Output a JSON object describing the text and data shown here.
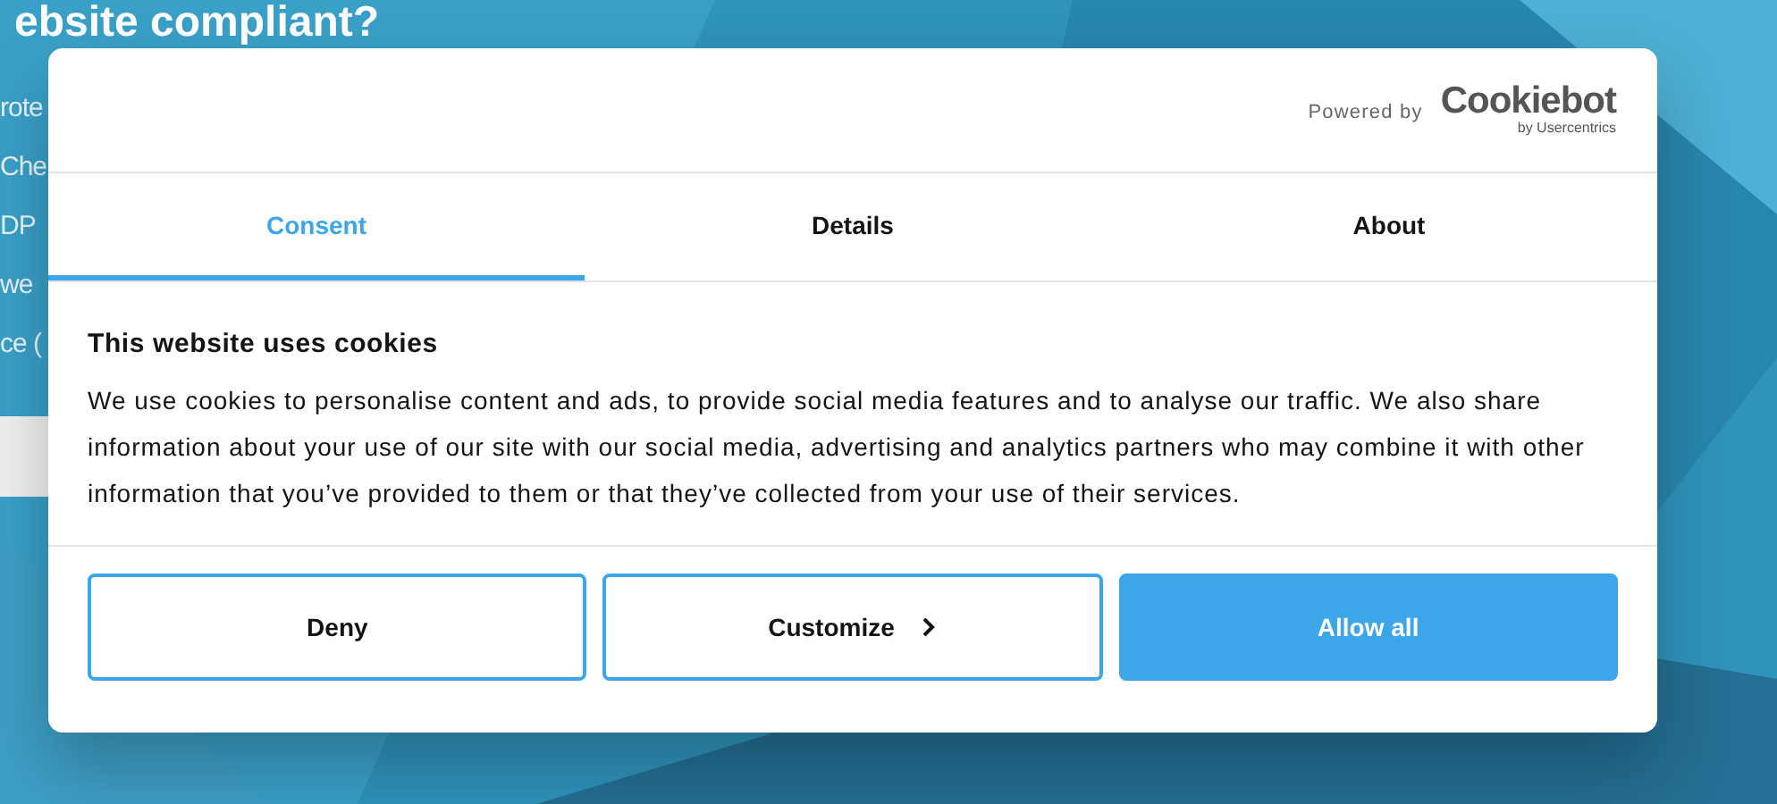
{
  "background": {
    "heading": "ebsite compliant?",
    "fragments": [
      "rote",
      "Che",
      "DP",
      "we",
      "ce ("
    ]
  },
  "dialog": {
    "powered_by": "Powered by",
    "brand": "Cookiebot",
    "brand_sub": "by Usercentrics",
    "tabs": [
      {
        "label": "Consent",
        "selected": true
      },
      {
        "label": "Details",
        "selected": false
      },
      {
        "label": "About",
        "selected": false
      }
    ],
    "title": "This website uses cookies",
    "text": "We use cookies to personalise content and ads, to provide social media features and to analyse our traffic. We also share information about your use of our site with our social media, advertising and analytics partners who may combine it with other information that you’ve provided to them or that they’ve collected from your use of their services.",
    "buttons": [
      {
        "label": "Deny",
        "kind": "outline"
      },
      {
        "label": "Customize",
        "kind": "chevron"
      },
      {
        "label": "Allow all",
        "kind": "primary"
      }
    ]
  }
}
